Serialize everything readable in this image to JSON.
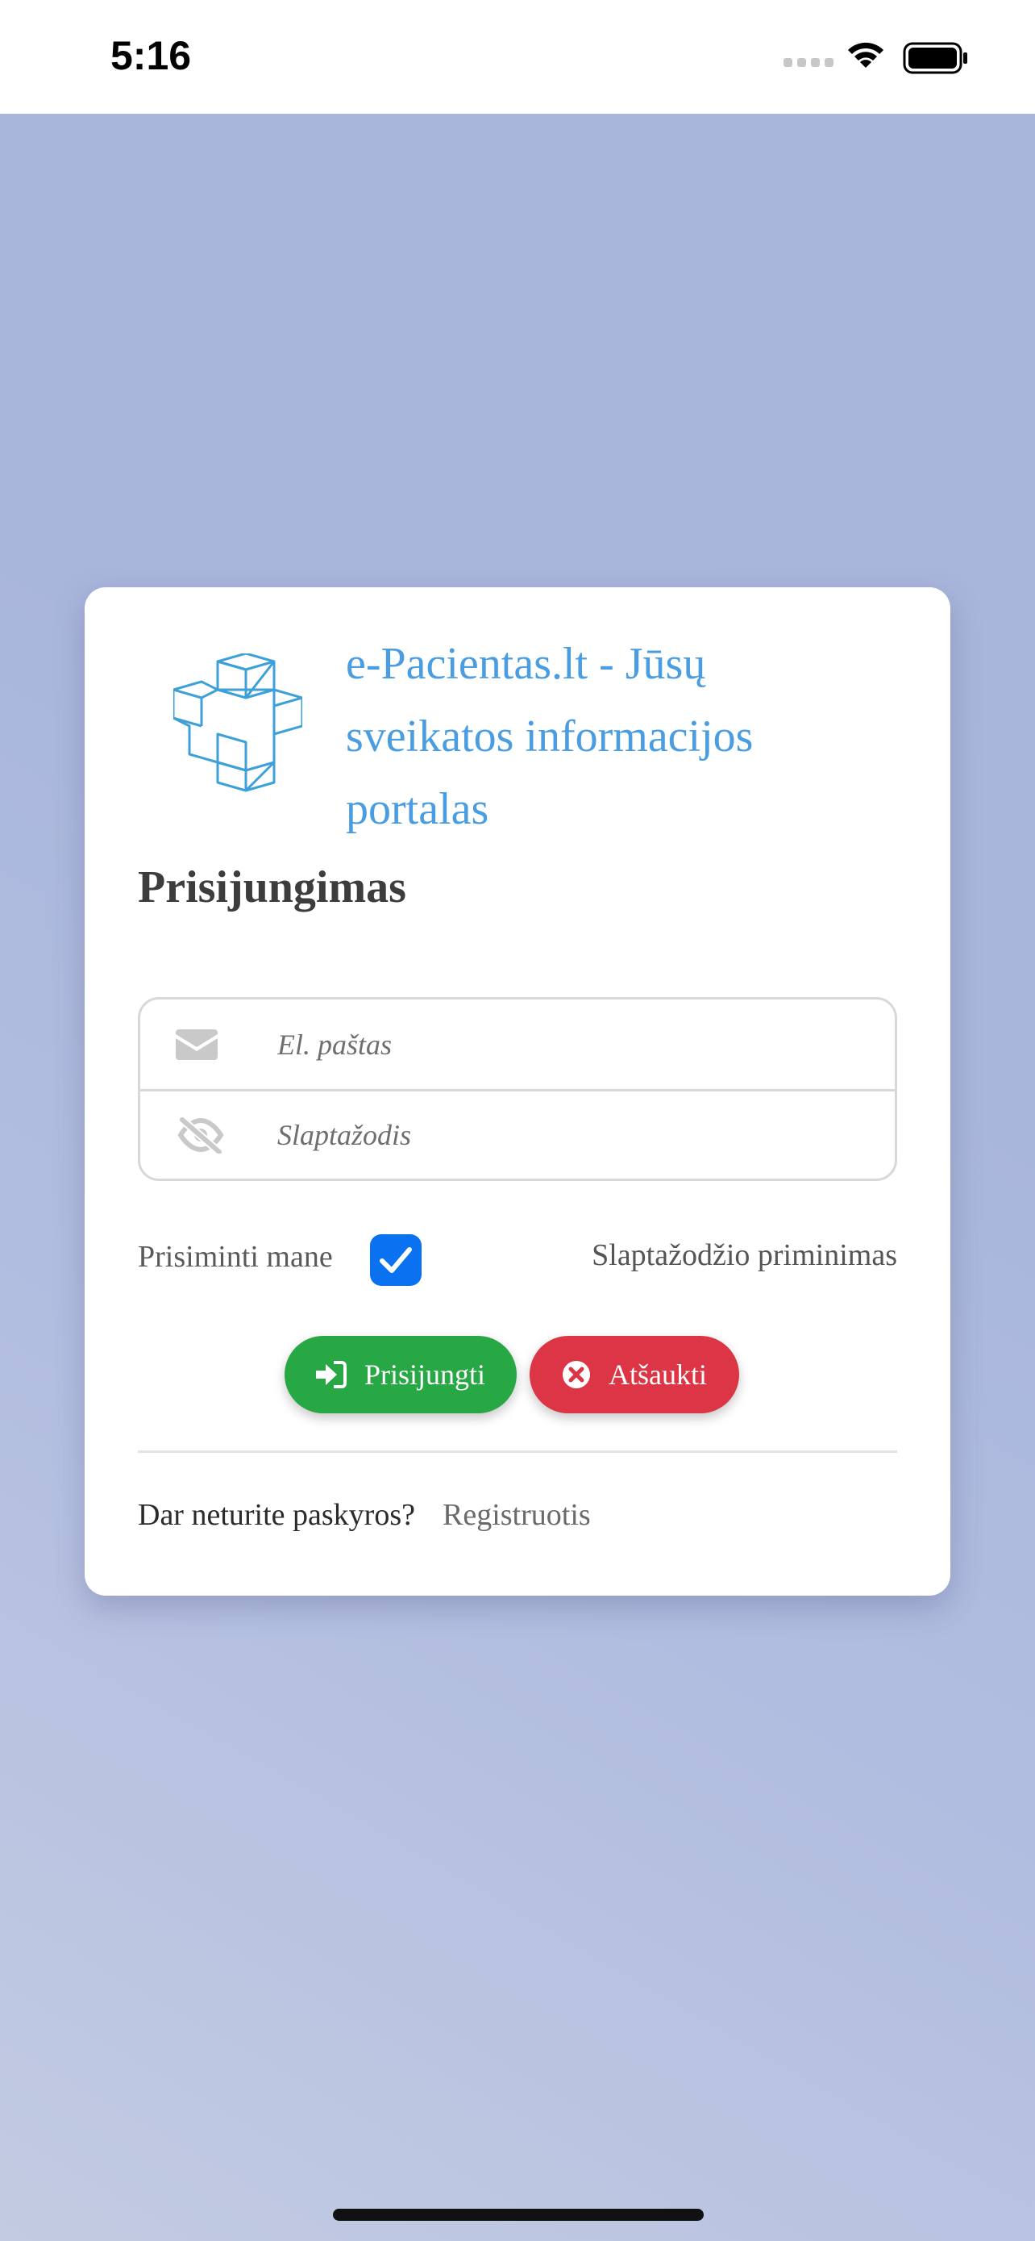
{
  "status_bar": {
    "time": "5:16"
  },
  "card": {
    "brand_title": "e-Pacientas.lt - Jūsų sveikatos informacijos portalas",
    "heading": "Prisijungimas",
    "email": {
      "placeholder": "El. paštas",
      "icon": "envelope-icon"
    },
    "password": {
      "placeholder": "Slaptažodis",
      "icon": "eye-slash-icon"
    },
    "remember_me": {
      "label": "Prisiminti mane",
      "checked": true
    },
    "password_reminder": "Slaptažodžio priminimas",
    "buttons": {
      "login": "Prisijungti",
      "cancel": "Atšaukti"
    },
    "no_account_text": "Dar neturite paskyros?",
    "register_link": "Registruotis"
  },
  "colors": {
    "brand": "#4a9de0",
    "login_button": "#28a745",
    "cancel_button": "#dc3545",
    "checkbox": "#0a72f1"
  }
}
